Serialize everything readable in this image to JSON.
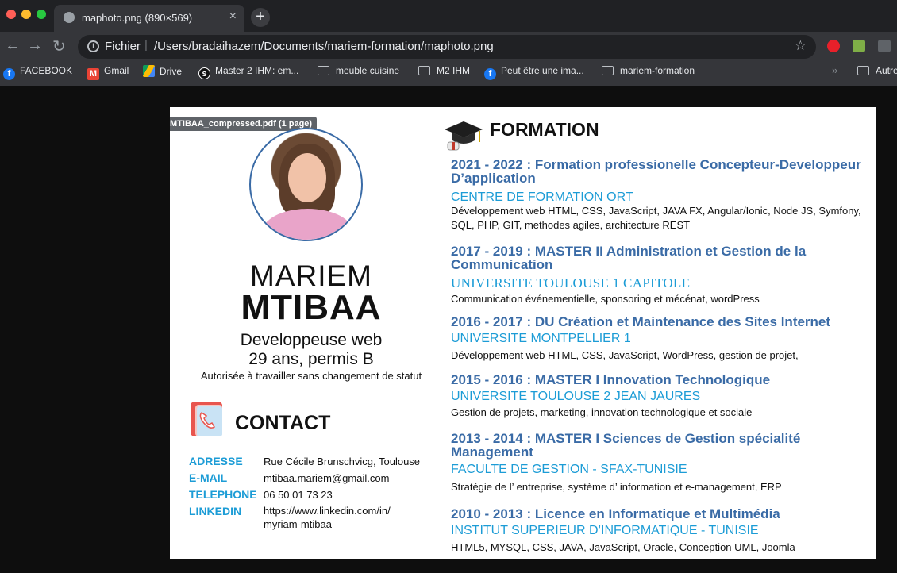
{
  "browser": {
    "tab_title": "maphoto.png (890×569)",
    "tab_close": "×",
    "new_tab": "+",
    "back": "←",
    "forward": "→",
    "reload": "↻",
    "scheme": "Fichier",
    "separator": "|",
    "url": "/Users/bradaihazem/Documents/mariem-formation/maphoto.png",
    "star": "☆",
    "bookmarks": [
      {
        "label": "FACEBOOK",
        "icon": "facebook-icon"
      },
      {
        "label": "Gmail",
        "icon": "gmail-icon"
      },
      {
        "label": "Drive",
        "icon": "drive-icon"
      },
      {
        "label": "Master 2 IHM: em...",
        "icon": "symfony-icon"
      },
      {
        "label": "meuble cuisine",
        "icon": "folder-icon"
      },
      {
        "label": "M2 IHM",
        "icon": "folder-icon"
      },
      {
        "label": "Peut être une ima...",
        "icon": "facebook-icon"
      },
      {
        "label": "mariem-formation",
        "icon": "folder-icon"
      }
    ],
    "bookmarks_more": "»",
    "other_bookmarks": "Autre"
  },
  "viewer": {
    "tooltip": "MTIBAA_compressed.pdf (1 page)"
  },
  "cv": {
    "first_name": "MARIEM",
    "last_name": "MTIBAA",
    "job": "Developpeuse web",
    "age": "29 ans, permis B",
    "status": "Autorisée à travailler sans changement de statut",
    "contact_title": "CONTACT",
    "contact": [
      {
        "label": "ADRESSE",
        "value": "Rue Cécile Brunschvicg,  Toulouse"
      },
      {
        "label": "E-MAIL",
        "value": "mtibaa.mariem@gmail.com"
      },
      {
        "label": "TELEPHONE",
        "value": "06 50 01 73 23"
      },
      {
        "label": "LINKEDIN",
        "value": "https://www.linkedin.com/in/",
        "value2": "myriam-mtibaa"
      }
    ],
    "formation_title": "FORMATION",
    "education": [
      {
        "title": "2021 - 2022 : Formation professionelle Concepteur-Developpeur D’application",
        "school": "CENTRE DE FORMATION ORT",
        "desc": "Développement web HTML, CSS, JavaScript, JAVA FX, Angular/Ionic, Node JS, Symfony, SQL,  PHP, GIT, methodes agiles, architecture REST"
      },
      {
        "title": "2017 - 2019 : MASTER II Administration et Gestion de la Communication",
        "school": "UNIVERSITE  TOULOUSE 1 CAPITOLE",
        "desc": "Communication événementielle, sponsoring et mécénat, wordPress"
      },
      {
        "title": "2016 - 2017 : DU Création et Maintenance des Sites Internet",
        "school": "UNIVERSITE MONTPELLIER 1",
        "desc": "Développement web HTML, CSS, JavaScript, WordPress, gestion de projet,"
      },
      {
        "title": "2015 - 2016 : MASTER I Innovation Technologique",
        "school": "UNIVERSITE  TOULOUSE 2 JEAN JAURES",
        "desc": "Gestion de projets, marketing, innovation technologique et sociale"
      },
      {
        "title": "2013 - 2014 : MASTER I Sciences de Gestion spécialité Management",
        "school": "FACULTE DE GESTION - SFAX-TUNISIE",
        "desc": "Stratégie de l’ entreprise, système d’ information et e-management, ERP"
      },
      {
        "title": "2010 - 2013 : Licence en Informatique et Multimédia",
        "school": "INSTITUT SUPERIEUR D’INFORMATIQUE -  TUNISIE",
        "desc": "HTML5, MYSQL, CSS, JAVA, JavaScript, Oracle, Conception UML, Joomla"
      }
    ]
  }
}
